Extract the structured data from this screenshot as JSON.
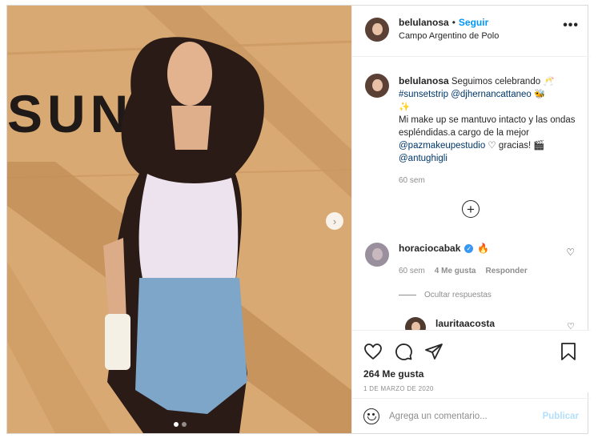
{
  "post": {
    "username": "belulanosa",
    "separator": "•",
    "follow_label": "Seguir",
    "location": "Campo Argentino de Polo",
    "more_icon": "more-horizontal-icon",
    "photo": {
      "sign_text": "SUNSET",
      "next_icon": "chevron-right-icon",
      "carousel_pages": 2,
      "carousel_active": 1
    }
  },
  "caption": {
    "username": "belulanosa",
    "text_1": " Seguimos celebrando ",
    "emoji_1": "🥂",
    "hashtag": "#sunsetstrip",
    "mention_1": "@djhernancattaneo",
    "emoji_2": "🐝",
    "emoji_3": "✨",
    "text_2": "Mi make up se mantuvo intacto y las ondas espléndidas.a cargo de la mejor ",
    "mention_2": "@pazmakeupestudio",
    "text_3": " gracias! ",
    "emoji_4": "🎬",
    "mention_3": "@antughigli",
    "time": "60 sem"
  },
  "load_more_icon": "plus-circle-icon",
  "comment": {
    "username": "horaciocabak",
    "emoji": "🔥",
    "time": "60 sem",
    "likes": "4 Me gusta",
    "reply_label": "Responder",
    "hide_replies_label": "Ocultar respuestas",
    "reply_username": "lauritaacosta"
  },
  "actions": {
    "likes_text": "264 Me gusta",
    "date": "1 DE MARZO DE 2020"
  },
  "comment_box": {
    "placeholder": "Agrega un comentario...",
    "publish_label": "Publicar"
  },
  "colors": {
    "link_blue": "#0095f6",
    "tag_blue": "#00376b",
    "muted_gray": "#8e8e8e",
    "publish_disabled": "#b2dffc"
  }
}
